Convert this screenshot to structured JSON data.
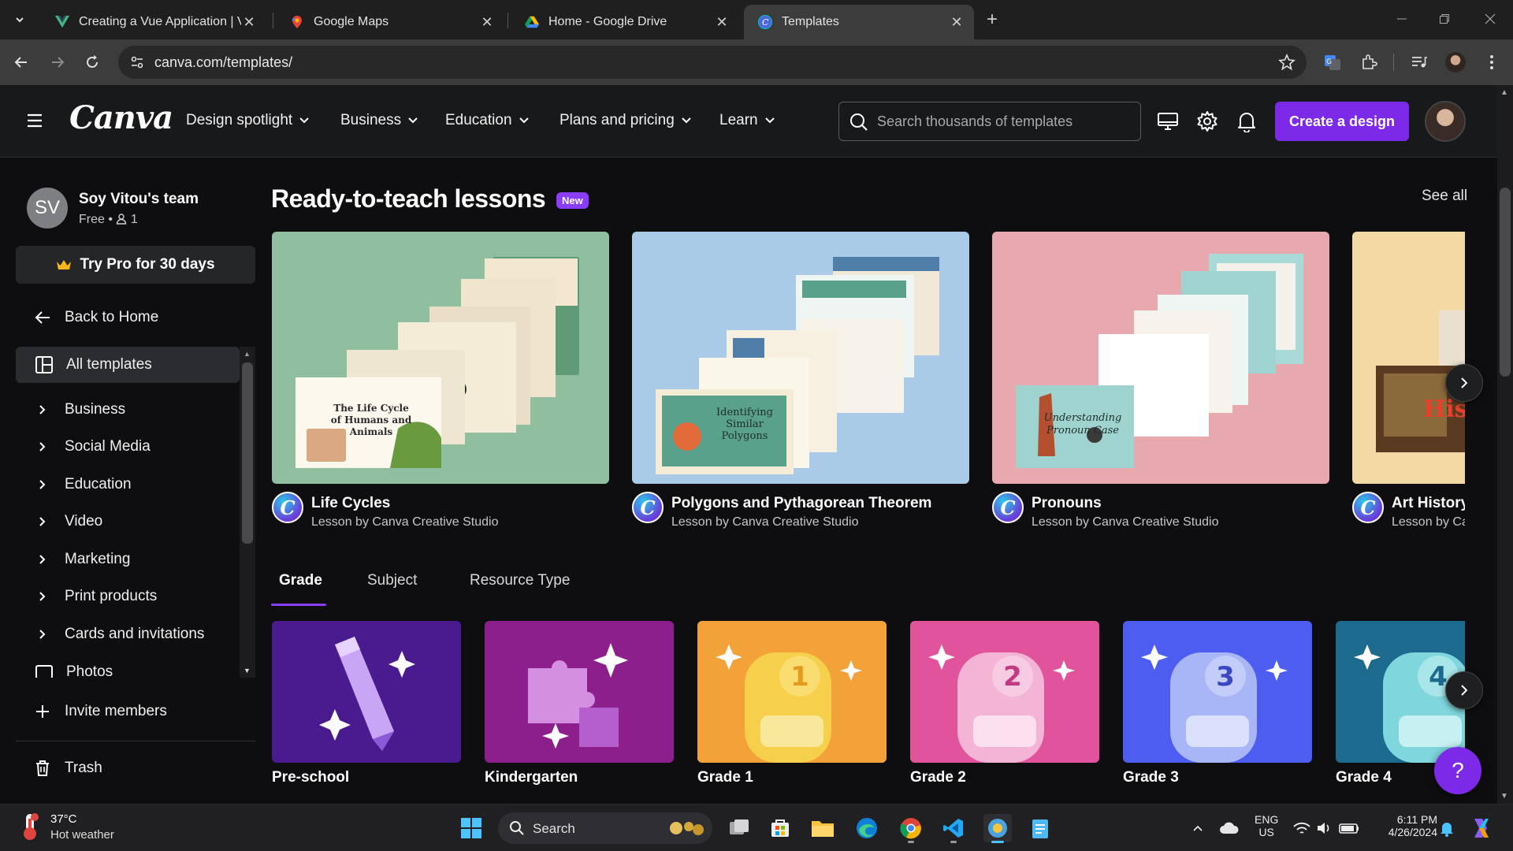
{
  "browser": {
    "tabs": [
      {
        "title": "Creating a Vue Application | Vue.js",
        "active": false,
        "favicon": "vue-icon"
      },
      {
        "title": "Google Maps",
        "active": false,
        "favicon": "maps-icon"
      },
      {
        "title": "Home - Google Drive",
        "active": false,
        "favicon": "drive-icon"
      },
      {
        "title": "Templates",
        "active": true,
        "favicon": "canva-icon"
      }
    ],
    "url": "canva.com/templates/"
  },
  "header": {
    "logo": "Canva",
    "nav": [
      {
        "label": "Design spotlight"
      },
      {
        "label": "Business"
      },
      {
        "label": "Education"
      },
      {
        "label": "Plans and pricing"
      },
      {
        "label": "Learn"
      }
    ],
    "search_placeholder": "Search thousands of templates",
    "create_button": "Create a design",
    "accent": "#7d2ae8"
  },
  "sidebar": {
    "team_initials": "SV",
    "team_name": "Soy Vitou's team",
    "team_plan": "Free • ",
    "team_members": "1",
    "try_pro": "Try Pro for 30 days",
    "back_home": "Back to Home",
    "all_templates": "All templates",
    "categories": [
      {
        "label": "Business"
      },
      {
        "label": "Social Media"
      },
      {
        "label": "Education"
      },
      {
        "label": "Video"
      },
      {
        "label": "Marketing"
      },
      {
        "label": "Print products"
      },
      {
        "label": "Cards and invitations"
      },
      {
        "label": "Photos"
      }
    ],
    "invite": "Invite members",
    "trash": "Trash"
  },
  "main": {
    "section_title": "Ready-to-teach lessons",
    "new_badge": "New",
    "see_all": "See all",
    "lessons": [
      {
        "title": "Life Cycles",
        "subtitle": "Lesson by Canva Creative Studio",
        "bg": "#8fbf9f",
        "card_text": "The Life Cycle of Humans and Animals"
      },
      {
        "title": "Polygons and Pythagorean Theorem",
        "subtitle": "Lesson by Canva Creative Studio",
        "bg": "#a9cbe8",
        "card_text": "Identifying Similar Polygons"
      },
      {
        "title": "Pronouns",
        "subtitle": "Lesson by Canva Creative Studio",
        "bg": "#e7a9ad",
        "card_text": "Understanding Pronoun Case"
      },
      {
        "title": "Art History",
        "subtitle": "Lesson by Canva Creative Studio",
        "bg": "#f3d9a4",
        "card_text": "Hist"
      }
    ],
    "filter_tabs": [
      {
        "label": "Grade",
        "active": true
      },
      {
        "label": "Subject",
        "active": false
      },
      {
        "label": "Resource Type",
        "active": false
      }
    ],
    "grades": [
      {
        "label": "Pre-school",
        "bg": "#4a1a8f",
        "num": ""
      },
      {
        "label": "Kindergarten",
        "bg": "#8c1f8c",
        "num": ""
      },
      {
        "label": "Grade 1",
        "bg": "#f3a23a",
        "num": "1"
      },
      {
        "label": "Grade 2",
        "bg": "#e1549b",
        "num": "2"
      },
      {
        "label": "Grade 3",
        "bg": "#4c5df0",
        "num": "3"
      },
      {
        "label": "Grade 4",
        "bg": "#1c6a8e",
        "num": "4"
      }
    ]
  },
  "taskbar": {
    "temperature": "37°C",
    "condition": "Hot weather",
    "search": "Search",
    "lang1": "ENG",
    "lang2": "US",
    "time": "6:11 PM",
    "date": "4/26/2024"
  }
}
